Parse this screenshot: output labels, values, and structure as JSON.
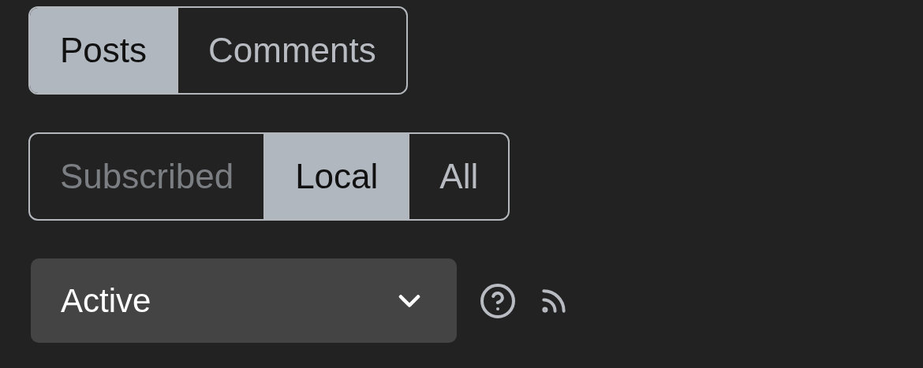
{
  "content_type_tabs": [
    {
      "label": "Posts",
      "selected": true
    },
    {
      "label": "Comments",
      "selected": false
    }
  ],
  "listing_type_tabs": [
    {
      "label": "Subscribed",
      "selected": false,
      "disabled": true
    },
    {
      "label": "Local",
      "selected": true,
      "disabled": false
    },
    {
      "label": "All",
      "selected": false,
      "disabled": false
    }
  ],
  "sort_select": {
    "value": "Active"
  }
}
